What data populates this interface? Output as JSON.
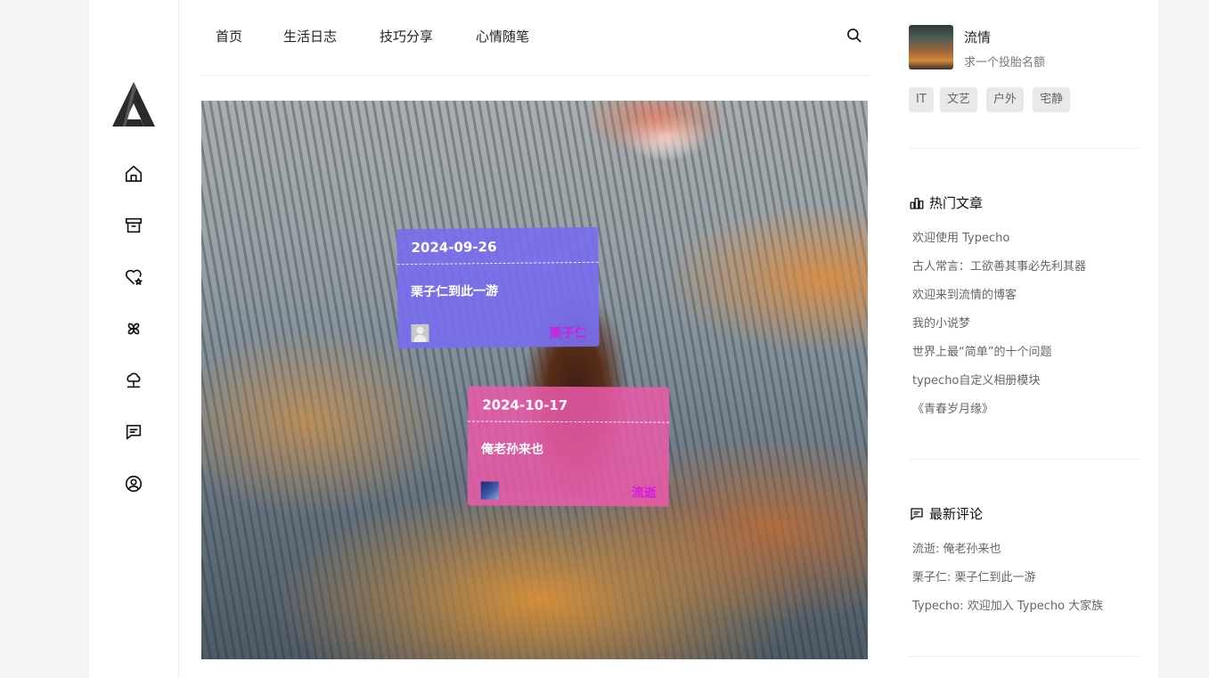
{
  "topnav": {
    "items": [
      "首页",
      "生活日志",
      "技巧分享",
      "心情随笔"
    ]
  },
  "sidebar_icons": [
    "home-icon",
    "archive-icon",
    "heart-star-icon",
    "pinwheel-icon",
    "cloud-icon",
    "message-icon",
    "user-circle-icon"
  ],
  "notes": [
    {
      "date": "2024-09-26",
      "text": "栗子仁到此一游",
      "author": "栗子仁",
      "color": "#786eee"
    },
    {
      "date": "2024-10-17",
      "text": "俺老孙来也",
      "author": "流逝",
      "color": "#ec5aaa"
    }
  ],
  "profile": {
    "name": "流情",
    "bio": "求一个投胎名额",
    "tags": [
      "IT",
      "文艺",
      "户外",
      "宅静"
    ]
  },
  "hot_posts": {
    "title": "热门文章",
    "items": [
      "欢迎使用 Typecho",
      "古人常言：工欲善其事必先利其器",
      "欢迎来到流情的博客",
      "我的小说梦",
      "世界上最“简单”的十个问题",
      "typecho自定义相册模块",
      "《青春岁月缘》"
    ]
  },
  "recent_comments": {
    "title": "最新评论",
    "items": [
      "流逝: 俺老孙来也",
      "栗子仁: 栗子仁到此一游",
      "Typecho: 欢迎加入 Typecho 大家族"
    ]
  }
}
